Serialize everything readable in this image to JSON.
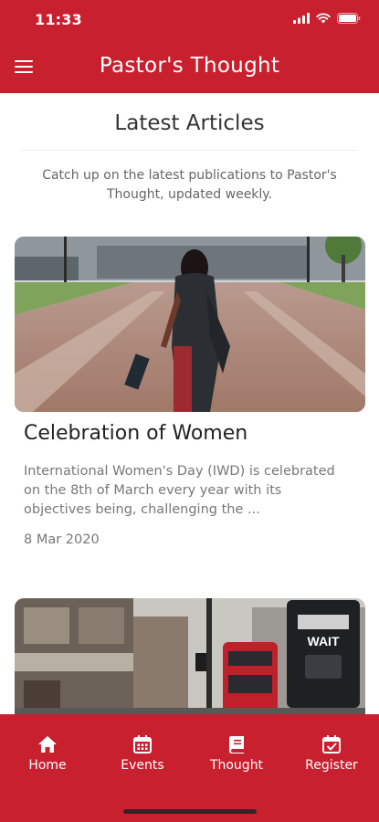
{
  "status": {
    "time": "11:33",
    "icons": [
      "signal-icon",
      "wifi-icon",
      "battery-icon"
    ]
  },
  "header": {
    "title": "Pastor's Thought",
    "menu_icon": "hamburger-menu-icon"
  },
  "section": {
    "title": "Latest Articles",
    "subtitle": "Catch up on the latest publications to Pastor's Thought, updated weekly."
  },
  "articles": [
    {
      "title": "Celebration of Women",
      "excerpt": "International Women's Day (IWD) is celebrated on the 8th of March every year with its objectives being, challenging the ...",
      "date": "8 Mar 2020",
      "image": "woman-walking-photo"
    },
    {
      "image": "city-street-photo",
      "sign_text": "WAIT"
    }
  ],
  "bottom_nav": [
    {
      "label": "Home",
      "icon": "home-icon"
    },
    {
      "label": "Events",
      "icon": "calendar-icon"
    },
    {
      "label": "Thought",
      "icon": "book-icon"
    },
    {
      "label": "Register",
      "icon": "calendar-check-icon"
    }
  ],
  "colors": {
    "brand": "#c8202e",
    "text": "#222222",
    "muted": "#777777"
  }
}
